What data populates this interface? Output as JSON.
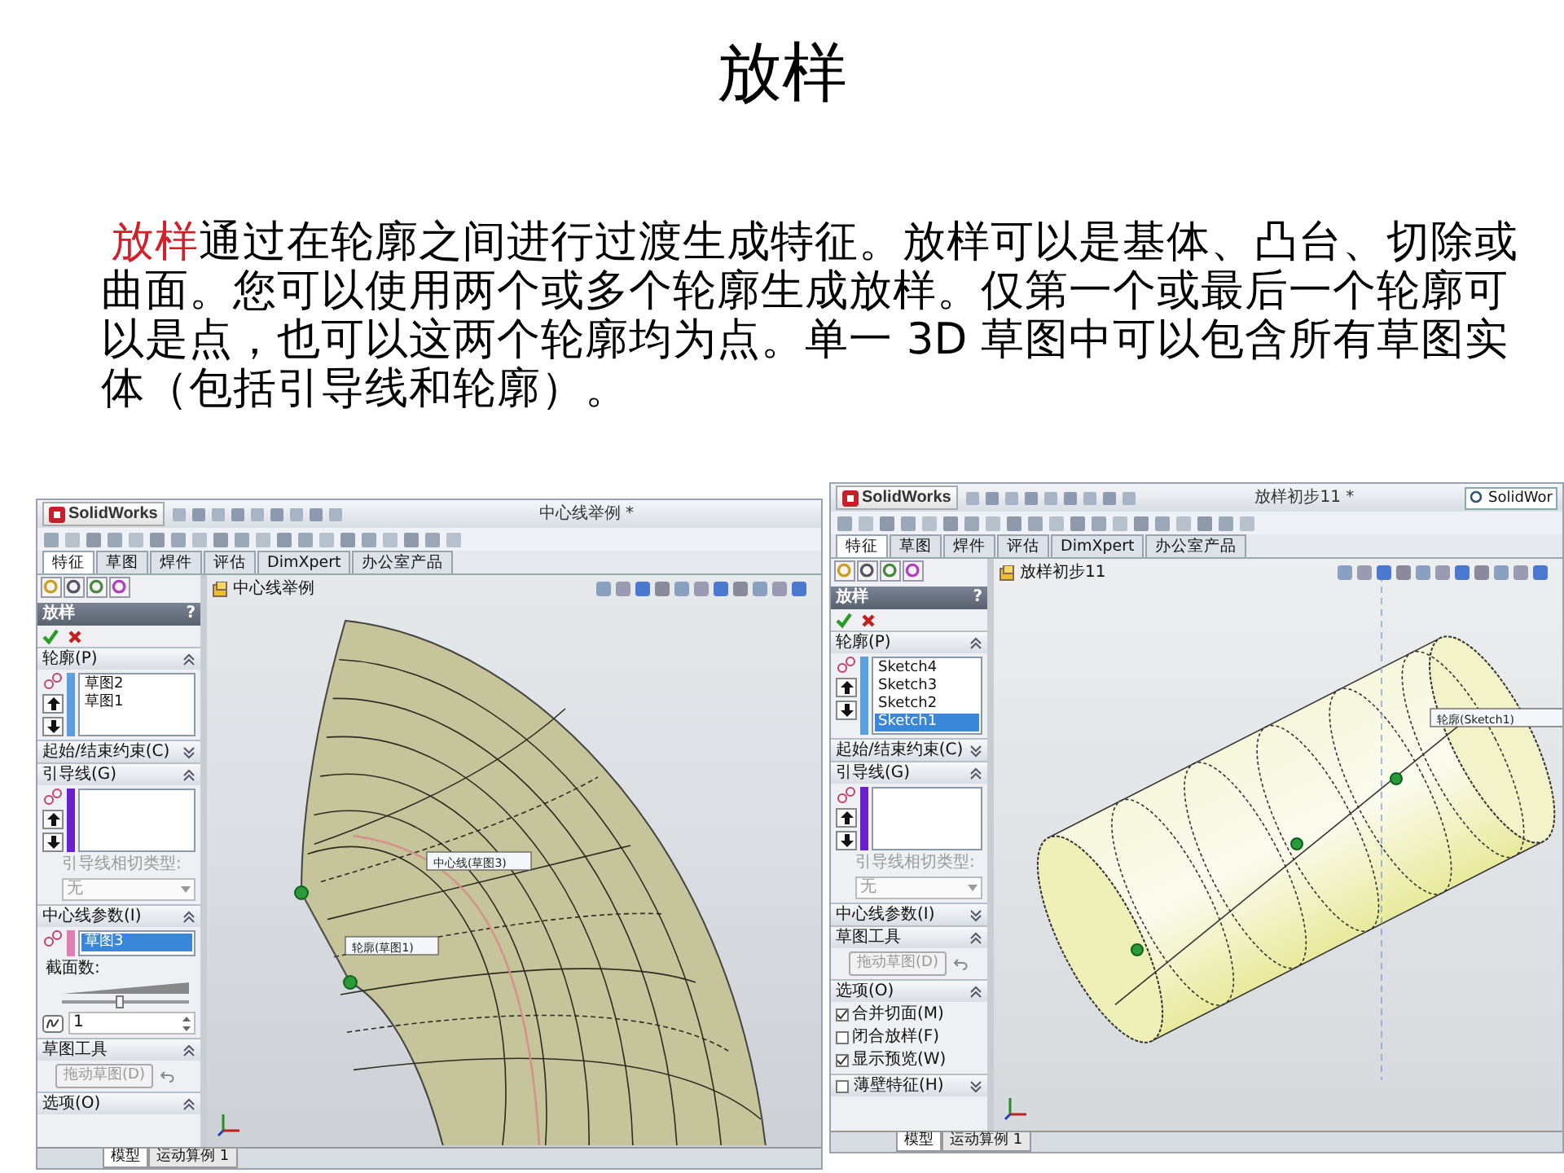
{
  "slide": {
    "title": "放样",
    "intro": {
      "highlight": "放样",
      "text": "通过在轮廓之间进行过渡生成特征。放样可以是基体、凸台、切除或曲面。您可以使用两个或多个轮廓生成放样。仅第一个或最后一个轮廓可以是点，也可以这两个轮廓均为点。单一 3D 草图中可以包含所有草图实体（包括引导线和轮廓）。"
    }
  },
  "screenshots": [
    {
      "logo": "SolidWorks",
      "doc_title": "中心线举例 *",
      "tabs": [
        {
          "label": "特征",
          "selected": true
        },
        {
          "label": "草图",
          "selected": false
        },
        {
          "label": "焊件",
          "selected": false
        },
        {
          "label": "评估",
          "selected": false
        },
        {
          "label": "DimXpert",
          "selected": false
        },
        {
          "label": "办公室产品",
          "selected": false
        }
      ],
      "tree_root": "中心线举例",
      "property_manager": {
        "title": "放样",
        "help": "?",
        "sections": [
          {
            "heading": "轮廓(P)",
            "expanded": true,
            "rows": [
              {
                "kind": "ordered-list",
                "color": "#5aa0e0",
                "items": [
                  {
                    "label": "草图2",
                    "selected": false
                  },
                  {
                    "label": "草图1",
                    "selected": false
                  }
                ]
              }
            ]
          },
          {
            "heading": "起始/结束约束(C)",
            "expanded": false
          },
          {
            "heading": "引导线(G)",
            "expanded": true,
            "rows": [
              {
                "kind": "ordered-list",
                "color": "#6a1fd0"
              },
              {
                "kind": "label",
                "text": "引导线相切类型:",
                "disabled": true
              },
              {
                "kind": "dropdown",
                "value": "无",
                "disabled": true
              }
            ]
          },
          {
            "heading": "中心线参数(I)",
            "expanded": true,
            "rows": [
              {
                "kind": "list",
                "color": "#e07fb0",
                "items": [
                  {
                    "label": "草图3",
                    "selected": true
                  }
                ]
              },
              {
                "kind": "label",
                "text": "截面数:",
                "disabled": false
              },
              {
                "kind": "slider",
                "level": 0.45
              },
              {
                "kind": "spinner",
                "value": "1"
              }
            ]
          },
          {
            "heading": "草图工具",
            "expanded": true,
            "rows": [
              {
                "kind": "button",
                "label": "拖动草图(D)",
                "disabled": true
              }
            ]
          },
          {
            "heading": "选项(O)",
            "expanded": true
          }
        ]
      },
      "model": {
        "kind": "arc-loft",
        "callouts": [
          "中心线(草图3)",
          "轮廓(草图1)"
        ]
      },
      "bottom_tabs": [
        {
          "label": "模型",
          "selected": true
        },
        {
          "label": "运动算例 1",
          "selected": false
        }
      ]
    },
    {
      "logo": "SolidWorks",
      "doc_title": "放样初步11 *",
      "search": "SolidWor",
      "tabs": [
        {
          "label": "特征",
          "selected": true
        },
        {
          "label": "草图",
          "selected": false
        },
        {
          "label": "焊件",
          "selected": false
        },
        {
          "label": "评估",
          "selected": false
        },
        {
          "label": "DimXpert",
          "selected": false
        },
        {
          "label": "办公室产品",
          "selected": false
        }
      ],
      "tree_root": "放样初步11",
      "property_manager": {
        "title": "放样",
        "help": "?",
        "sections": [
          {
            "heading": "轮廓(P)",
            "expanded": true,
            "rows": [
              {
                "kind": "ordered-list",
                "color": "#5aa0e0",
                "items": [
                  {
                    "label": "Sketch4",
                    "selected": false
                  },
                  {
                    "label": "Sketch3",
                    "selected": false
                  },
                  {
                    "label": "Sketch2",
                    "selected": false
                  },
                  {
                    "label": "Sketch1",
                    "selected": true
                  }
                ]
              }
            ]
          },
          {
            "heading": "起始/结束约束(C)",
            "expanded": false
          },
          {
            "heading": "引导线(G)",
            "expanded": true,
            "rows": [
              {
                "kind": "ordered-list",
                "color": "#6a1fd0"
              },
              {
                "kind": "label",
                "text": "引导线相切类型:",
                "disabled": true
              },
              {
                "kind": "dropdown",
                "value": "无",
                "disabled": true
              }
            ]
          },
          {
            "heading": "中心线参数(I)",
            "expanded": false
          },
          {
            "heading": "草图工具",
            "expanded": true,
            "rows": [
              {
                "kind": "button",
                "label": "拖动草图(D)",
                "disabled": true
              }
            ]
          },
          {
            "heading": "选项(O)",
            "expanded": true,
            "rows": [
              {
                "kind": "checkbox",
                "label": "合并切面(M)",
                "checked": true
              },
              {
                "kind": "checkbox",
                "label": "闭合放样(F)",
                "checked": false
              },
              {
                "kind": "checkbox",
                "label": "显示预览(W)",
                "checked": true
              }
            ]
          },
          {
            "heading": "薄壁特征(H)",
            "expanded": false,
            "checked": false
          }
        ]
      },
      "model": {
        "kind": "cylinder-loft",
        "callouts": [
          "轮廓(Sketch1)"
        ]
      },
      "bottom_tabs": [
        {
          "label": "模型",
          "selected": true
        },
        {
          "label": "运动算例 1",
          "selected": false
        }
      ]
    }
  ]
}
